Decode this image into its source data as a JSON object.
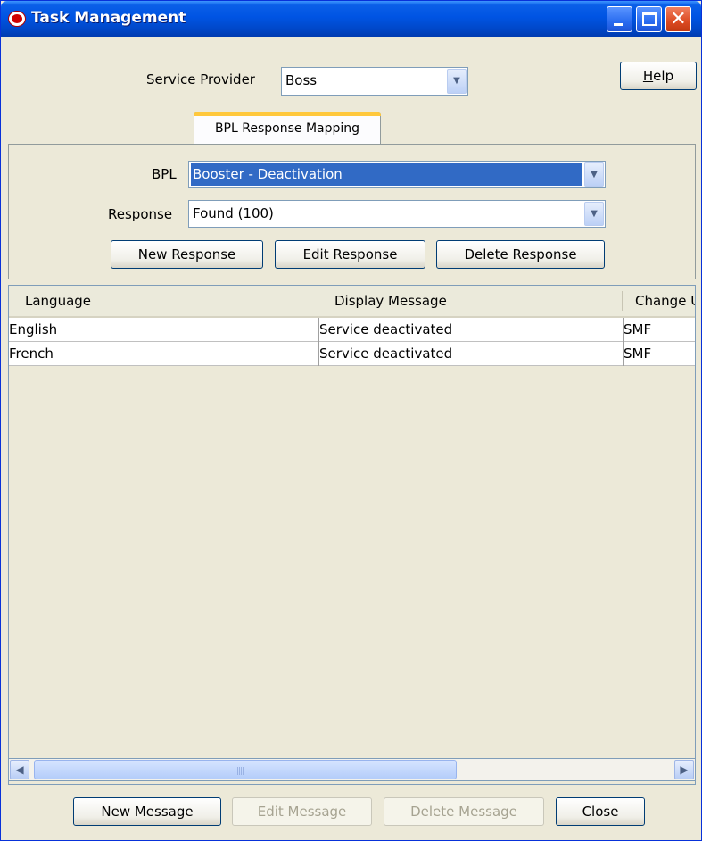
{
  "window": {
    "title": "Task Management"
  },
  "header": {
    "service_provider_label": "Service Provider",
    "service_provider_value": "Boss",
    "help_button": "Help"
  },
  "tabs": [
    {
      "label": "BPL Response Mapping",
      "active": true
    }
  ],
  "form": {
    "bpl_label": "BPL",
    "bpl_value": "Booster - Deactivation",
    "response_label": "Response",
    "response_value": "Found (100)",
    "new_response": "New Response",
    "edit_response": "Edit Response",
    "delete_response": "Delete Response"
  },
  "table": {
    "columns": [
      "Language",
      "Display Message",
      "Change U"
    ],
    "rows": [
      [
        "English",
        "Service deactivated",
        "SMF"
      ],
      [
        "French",
        "Service deactivated",
        "SMF"
      ]
    ]
  },
  "footer": {
    "new_message": "New Message",
    "edit_message": "Edit Message",
    "delete_message": "Delete Message",
    "close": "Close"
  },
  "icons": {
    "app": "oracle-icon",
    "minimize": "minimize-icon",
    "maximize": "maximize-icon",
    "close": "close-icon",
    "dropdown": "chevron-down-icon",
    "scroll_left": "arrow-left-icon",
    "scroll_right": "arrow-right-icon"
  },
  "colors": {
    "title_bar": "#0054e3",
    "selection": "#316ac5",
    "tab_accent": "#ffc83c"
  }
}
